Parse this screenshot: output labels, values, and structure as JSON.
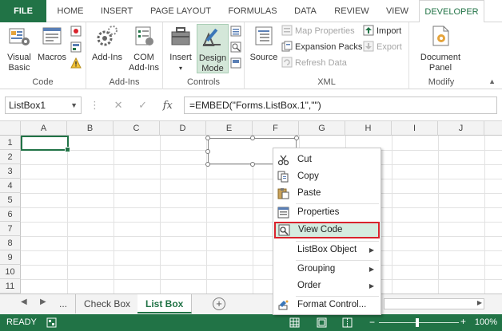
{
  "tabs": [
    {
      "label": "FILE",
      "id": "file"
    },
    {
      "label": "HOME",
      "id": "home"
    },
    {
      "label": "INSERT",
      "id": "insert"
    },
    {
      "label": "PAGE LAYOUT",
      "id": "page-layout"
    },
    {
      "label": "FORMULAS",
      "id": "formulas"
    },
    {
      "label": "DATA",
      "id": "data"
    },
    {
      "label": "REVIEW",
      "id": "review"
    },
    {
      "label": "VIEW",
      "id": "view"
    },
    {
      "label": "DEVELOPER",
      "id": "developer",
      "active": true
    }
  ],
  "ribbon": {
    "code": {
      "label": "Code",
      "visual_basic": "Visual\nBasic",
      "macros": "Macros"
    },
    "addins": {
      "label": "Add-Ins",
      "addins": "Add-Ins",
      "com_addins": "COM\nAdd-Ins"
    },
    "controls": {
      "label": "Controls",
      "insert": "Insert",
      "design_mode": "Design\nMode"
    },
    "xml": {
      "label": "XML",
      "source": "Source",
      "map_properties": "Map Properties",
      "expansion_packs": "Expansion Packs",
      "refresh_data": "Refresh Data",
      "import": "Import",
      "export": "Export"
    },
    "modify": {
      "label": "Modify",
      "document_panel": "Document\nPanel"
    }
  },
  "formula_bar": {
    "name_box": "ListBox1",
    "fx": "fx",
    "formula": "=EMBED(\"Forms.ListBox.1\",\"\")"
  },
  "grid": {
    "columns": [
      "A",
      "B",
      "C",
      "D",
      "E",
      "F",
      "G",
      "H",
      "I",
      "J"
    ],
    "rows": [
      "1",
      "2",
      "3",
      "4",
      "5",
      "6",
      "7",
      "8",
      "9",
      "10",
      "11"
    ]
  },
  "sheets": {
    "ellipsis": "...",
    "tabs": [
      {
        "label": "Check Box",
        "active": false
      },
      {
        "label": "List Box",
        "active": true
      }
    ]
  },
  "status": {
    "ready": "READY",
    "zoom": "100%"
  },
  "context_menu": {
    "items": [
      {
        "label": "Cut",
        "icon": "scissors-icon"
      },
      {
        "label": "Copy",
        "icon": "copy-icon"
      },
      {
        "label": "Paste",
        "icon": "paste-icon"
      },
      {
        "label": "Properties",
        "icon": "properties-icon"
      },
      {
        "label": "View Code",
        "icon": "view-code-icon",
        "highlighted": true
      },
      {
        "label": "ListBox Object",
        "submenu": true
      },
      {
        "label": "Grouping",
        "submenu": true
      },
      {
        "label": "Order",
        "submenu": true
      },
      {
        "label": "Format Control...",
        "icon": "format-control-icon"
      }
    ]
  },
  "colors": {
    "accent": "#217346",
    "highlight_border": "#d9232d",
    "highlight_fill": "#d5ece0"
  }
}
